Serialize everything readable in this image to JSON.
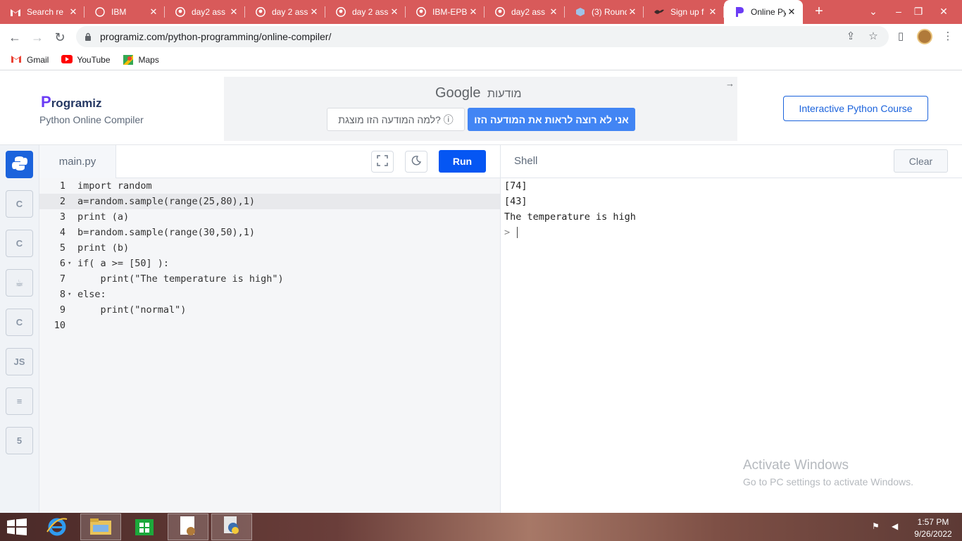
{
  "browser": {
    "tabs": [
      {
        "title": "Search re",
        "icon": "gmail-icon"
      },
      {
        "title": "IBM",
        "icon": "globe-icon"
      },
      {
        "title": "day2 ass",
        "icon": "github-icon"
      },
      {
        "title": "day 2 ass",
        "icon": "github-icon"
      },
      {
        "title": "day 2 ass",
        "icon": "github-icon"
      },
      {
        "title": "IBM-EPB",
        "icon": "github-icon"
      },
      {
        "title": "day2 ass",
        "icon": "github-icon"
      },
      {
        "title": "(3) Round",
        "icon": "cube-icon"
      },
      {
        "title": "Sign up f",
        "icon": "bird-icon"
      },
      {
        "title": "Online Py",
        "icon": "programiz-icon"
      }
    ],
    "url": "programiz.com/python-programming/online-compiler/",
    "bookmarks": [
      {
        "label": "Gmail",
        "icon": "gmail-icon"
      },
      {
        "label": "YouTube",
        "icon": "youtube-icon"
      },
      {
        "label": "Maps",
        "icon": "maps-icon"
      }
    ]
  },
  "site": {
    "logo_text": "rogramiz",
    "logo_p": "P",
    "subtitle": "Python Online Compiler",
    "course_button": "Interactive Python Course"
  },
  "ad": {
    "google": "Google",
    "label": "מודעות",
    "why": "למה המודעה הזו מוצגת? ⓘ",
    "stop": "אני לא רוצה לראות את המודעה הזו"
  },
  "rail": [
    {
      "name": "python",
      "label": "",
      "active": true
    },
    {
      "name": "c",
      "label": "C"
    },
    {
      "name": "cpp",
      "label": "C"
    },
    {
      "name": "java",
      "label": "☕"
    },
    {
      "name": "csharp",
      "label": "C"
    },
    {
      "name": "js",
      "label": "JS"
    },
    {
      "name": "sql",
      "label": "≡"
    },
    {
      "name": "html",
      "label": "5"
    }
  ],
  "editor": {
    "file_name": "main.py",
    "run_label": "Run",
    "lines": [
      "import random",
      "a=random.sample(range(25,80),1)",
      "print (a)",
      "b=random.sample(range(30,50),1)",
      "print (b)",
      "if( a >= [50] ):",
      "    print(\"The temperature is high\")",
      "else:",
      "    print(\"normal\")",
      ""
    ],
    "line_numbers": [
      "1",
      "2",
      "3",
      "4",
      "5",
      "6",
      "7",
      "8",
      "9",
      "10"
    ]
  },
  "shell": {
    "title": "Shell",
    "clear_label": "Clear",
    "output": [
      "[74]",
      "[43]",
      "The temperature is high"
    ],
    "prompt": ">"
  },
  "watermark": {
    "line1": "Activate Windows",
    "line2": "Go to PC settings to activate Windows."
  },
  "taskbar": {
    "time": "1:57 PM",
    "date": "9/26/2022"
  },
  "colors": {
    "tabstrip": "#d85a5a",
    "run": "#0556f3",
    "accent": "#1b63dc"
  }
}
